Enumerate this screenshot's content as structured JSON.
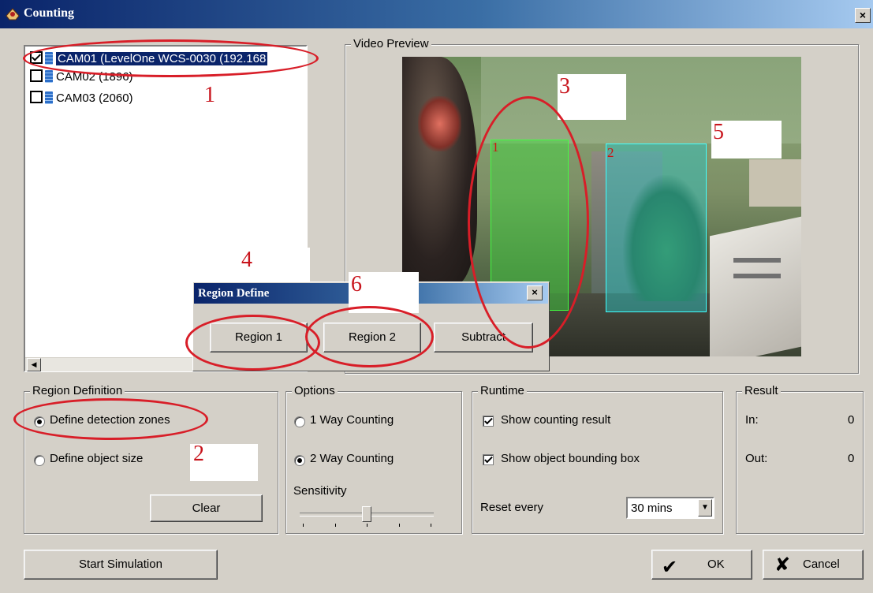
{
  "window": {
    "title": "Counting",
    "close_glyph": "×"
  },
  "camera_list": {
    "items": [
      {
        "label": "CAM01 (LevelOne WCS-0030 (192.168",
        "checked": true,
        "selected": true
      },
      {
        "label": "CAM02 (1896)",
        "checked": false,
        "selected": false
      },
      {
        "label": "CAM03 (2060)",
        "checked": false,
        "selected": false
      }
    ]
  },
  "video_preview": {
    "title": "Video Preview",
    "zones": [
      {
        "label": "1",
        "color": "#33dd33"
      },
      {
        "label": "2",
        "color": "#33cccc"
      }
    ]
  },
  "region_define": {
    "title": "Region Define",
    "close_glyph": "×",
    "buttons": [
      "Region 1",
      "Region 2",
      "Subtract"
    ]
  },
  "region_definition": {
    "title": "Region Definition",
    "options": [
      "Define detection zones",
      "Define object size"
    ],
    "selected": "Define detection zones",
    "clear_label": "Clear"
  },
  "options": {
    "title": "Options",
    "modes": [
      "1 Way Counting",
      "2 Way Counting"
    ],
    "selected": "2 Way Counting",
    "sensitivity_label": "Sensitivity",
    "sensitivity_level": 0.5
  },
  "runtime": {
    "title": "Runtime",
    "show_counting_result": "Show counting result",
    "show_bounding_box": "Show object bounding box",
    "reset_label": "Reset every",
    "reset_value": "30 mins"
  },
  "result": {
    "title": "Result",
    "in_label": "In:",
    "in_value": "0",
    "out_label": "Out:",
    "out_value": "0"
  },
  "footer": {
    "start_simulation": "Start Simulation",
    "ok": "OK",
    "cancel": "Cancel"
  },
  "annotations": [
    "1",
    "2",
    "3",
    "4",
    "5",
    "6"
  ],
  "colors": {
    "title_bar": "#0a246a",
    "annotation_red": "#d81e28",
    "window_bg": "#d4d0c8"
  }
}
